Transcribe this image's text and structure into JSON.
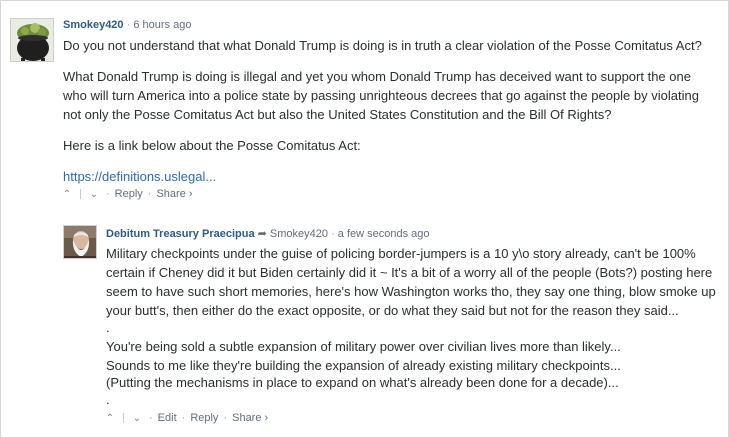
{
  "comments": [
    {
      "author": "Smokey420",
      "time": "6 hours ago",
      "paragraphs": [
        "Do you not understand that what Donald Trump is doing is in truth a clear violation of the Posse Comitatus Act?",
        "What Donald Trump is doing is illegal and yet you whom Donald Trump has deceived want to support the one",
        "who will turn America into a police state by passing unrighteous decrees that go against the people by violating",
        "not only the Posse Comitatus Act but also the United States Constitution and the Bill Of Rights?",
        "Here is a link below about the Posse Comitatus Act:"
      ],
      "link": "https://definitions.uslegal...",
      "actions": {
        "upvote": "⌃",
        "downvote": "⌄",
        "reply": "Reply",
        "share": "Share ›"
      }
    },
    {
      "author": "Debitum Treasury Praecipua",
      "reply_to": "Smokey420",
      "time": "a few seconds ago",
      "paragraphs": [
        "Military checkpoints under the guise of policing border-jumpers is a 10 y\\o story already, can't be 100%",
        "certain if Cheney did it but Biden certainly did it ~ It's a bit of a worry all of the people (Bots?) posting here",
        "seem to have such short memories, here's how Washington works tho, they say one thing, blow smoke up",
        "your butt's, then either do the exact opposite, or do what they said but not for the reason they said...",
        ".",
        "You're being sold a subtle expansion of military power over civilian lives more than likely...",
        "Sounds to me like they're building the expansion of already existing military checkpoints...",
        "(Putting the mechanisms in place to expand on what's already been done for a decade)...",
        "."
      ],
      "actions": {
        "upvote": "⌃",
        "downvote": "⌄",
        "edit": "Edit",
        "reply": "Reply",
        "share": "Share ›"
      }
    }
  ],
  "icons": {
    "reply_arrow": "arrow-right-icon"
  },
  "separator": "·"
}
